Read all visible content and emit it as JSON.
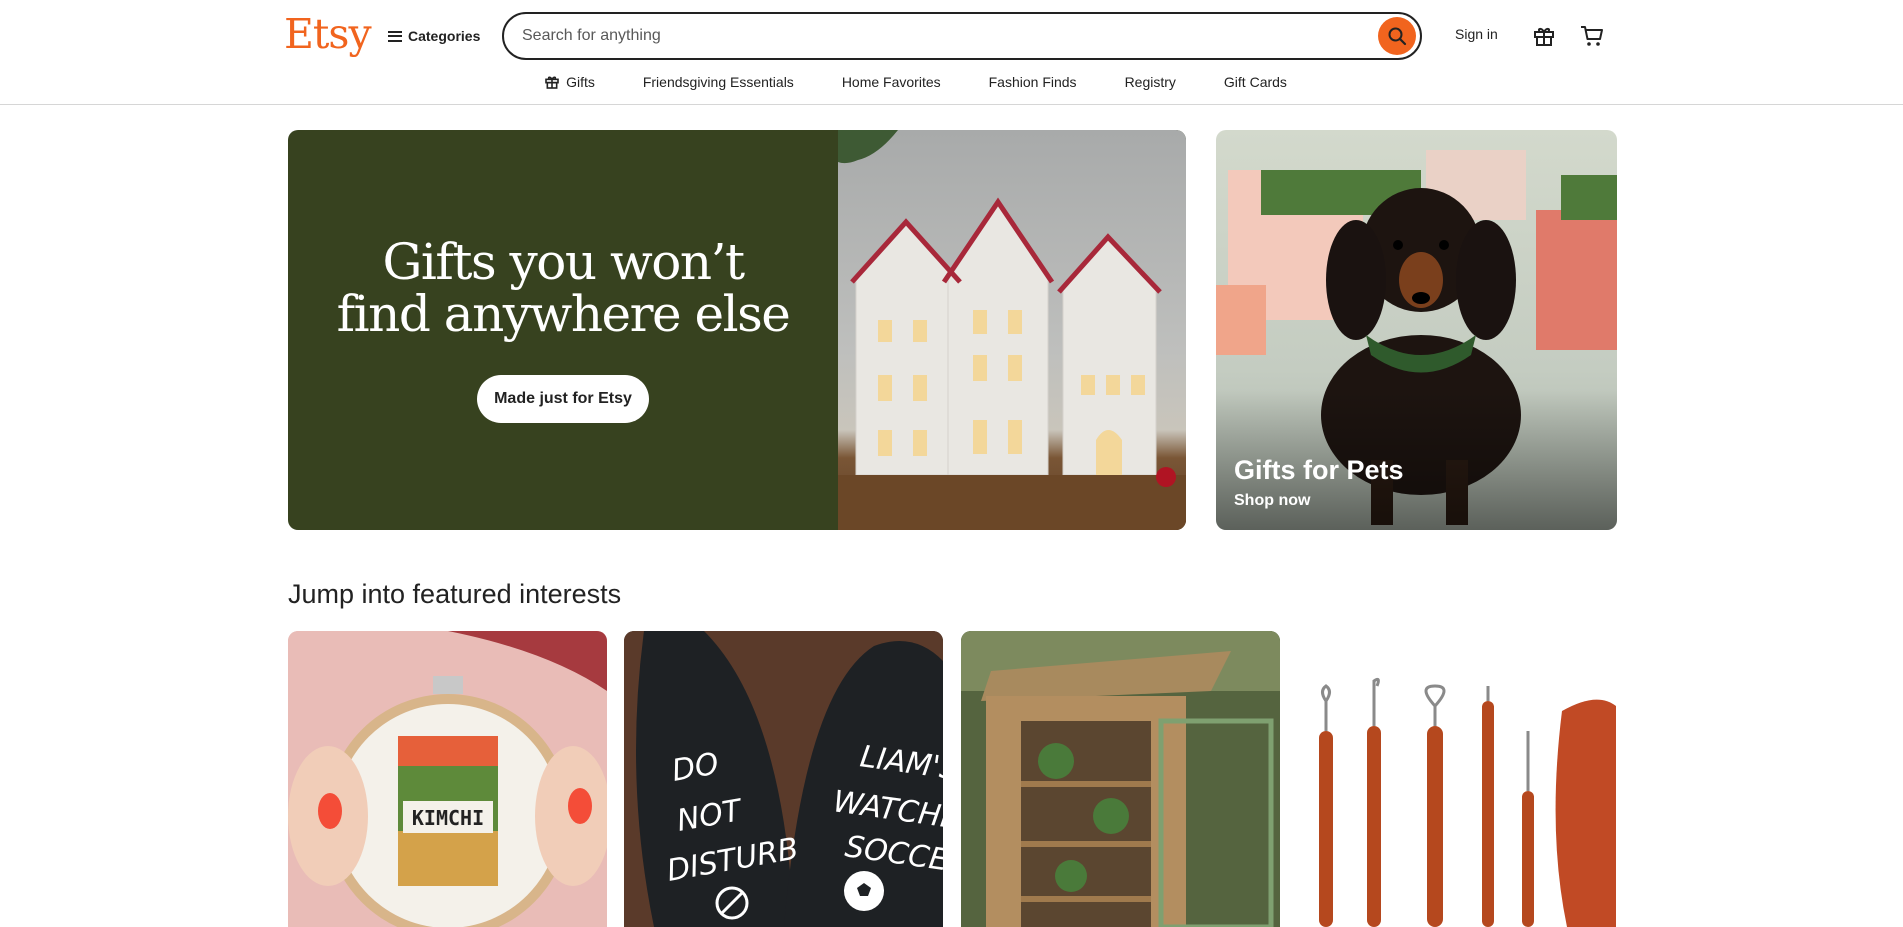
{
  "header": {
    "logo": "Etsy",
    "categories_label": "Categories",
    "search_placeholder": "Search for anything",
    "signin_label": "Sign in"
  },
  "nav": {
    "items": [
      {
        "label": "Gifts",
        "icon": "gift-icon"
      },
      {
        "label": "Friendsgiving Essentials"
      },
      {
        "label": "Home Favorites"
      },
      {
        "label": "Fashion Finds"
      },
      {
        "label": "Registry"
      },
      {
        "label": "Gift Cards"
      }
    ]
  },
  "hero": {
    "title_line1": "Gifts you won’t",
    "title_line2": "find anywhere else",
    "cta_label": "Made just for Etsy"
  },
  "promo": {
    "title": "Gifts for Pets",
    "subtitle": "Shop now"
  },
  "featured": {
    "heading": "Jump into featured interests",
    "tiles": [
      {
        "image": "kimchi-cross-stitch-hoop",
        "printed_text": "KIMCHI"
      },
      {
        "image": "novelty-soccer-socks",
        "printed_text_left": "DO NOT DISTURB",
        "printed_text_right": "LIAM'S WATCHING SOCCER"
      },
      {
        "image": "wooden-plant-cabinet"
      },
      {
        "image": "pottery-carving-tools"
      }
    ]
  },
  "colors": {
    "brand": "#f1641e",
    "hero_bg": "#37421f",
    "text": "#222222"
  }
}
